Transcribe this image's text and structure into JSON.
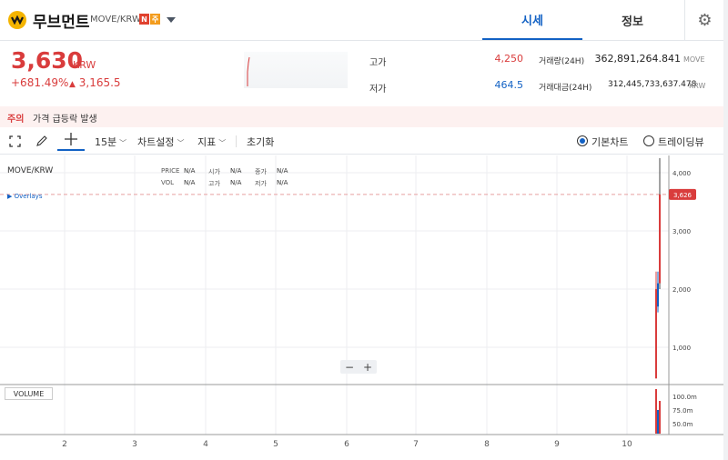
{
  "header": {
    "coin_name": "무브먼트",
    "pair": "MOVE/KRW",
    "badges": [
      "N",
      "주"
    ],
    "tabs": [
      {
        "label": "시세",
        "active": true
      },
      {
        "label": "정보",
        "active": false
      }
    ],
    "icons": {
      "logo": "coin-logo-icon",
      "dropdown": "chevron-down-icon",
      "settings": "gear-icon"
    }
  },
  "price": {
    "current": "3,630",
    "unit": "KRW",
    "change_rate": "+681.49%",
    "change_amount": "3,165.5",
    "change_arrow": "▲"
  },
  "stats": {
    "high_label": "고가",
    "high_value": "4,250",
    "low_label": "저가",
    "low_value": "464.5",
    "volume_label": "거래량(24H)",
    "volume_value": "362,891,264.841",
    "volume_unit": "MOVE",
    "amount_label": "거래대금(24H)",
    "amount_value": "312,445,733,637.478",
    "amount_unit": "KRW"
  },
  "warning": {
    "label": "주의",
    "text": "가격 급등락 발생"
  },
  "toolbar": {
    "interval": "15분",
    "chart_settings": "차트설정",
    "indicators": "지표",
    "reset": "초기화",
    "basic_chart": "기본차트",
    "trading_view": "트레이딩뷰",
    "selected_chart": "basic"
  },
  "chart": {
    "title": "MOVE/KRW",
    "overlays": "Overlays",
    "info_rows": [
      {
        "labels": [
          "PRICE",
          "시가",
          "종가"
        ],
        "values": [
          "N/A",
          "N/A",
          "N/A"
        ]
      },
      {
        "labels": [
          "VOL",
          "고가",
          "저가"
        ],
        "values": [
          "N/A",
          "N/A",
          "N/A"
        ]
      }
    ],
    "current_price_tag": "3,626",
    "volume_label": "VOLUME",
    "zoom_out": "−",
    "zoom_in": "+",
    "colors": {
      "up": "#d93c3c",
      "down": "#1261c4",
      "grid": "#eceef1"
    }
  },
  "chart_data": {
    "type": "candlestick",
    "x_ticks": [
      "2",
      "3",
      "4",
      "5",
      "6",
      "7",
      "8",
      "9",
      "10"
    ],
    "y_ticks": [
      "4,000",
      "3,000",
      "2,000",
      "1,000"
    ],
    "y_values": [
      4000,
      3000,
      2000,
      1000
    ],
    "volume_ticks": [
      "100.0m",
      "75.0m",
      "50.0m"
    ],
    "current_price": 3626,
    "candles": [
      {
        "open": 464.5,
        "close": 2000,
        "high": 2300,
        "low": 464.5
      },
      {
        "open": 1700,
        "close": 2100,
        "high": 2300,
        "low": 1600
      },
      {
        "open": 2100,
        "close": 3626,
        "high": 4250,
        "low": 2000
      }
    ]
  }
}
